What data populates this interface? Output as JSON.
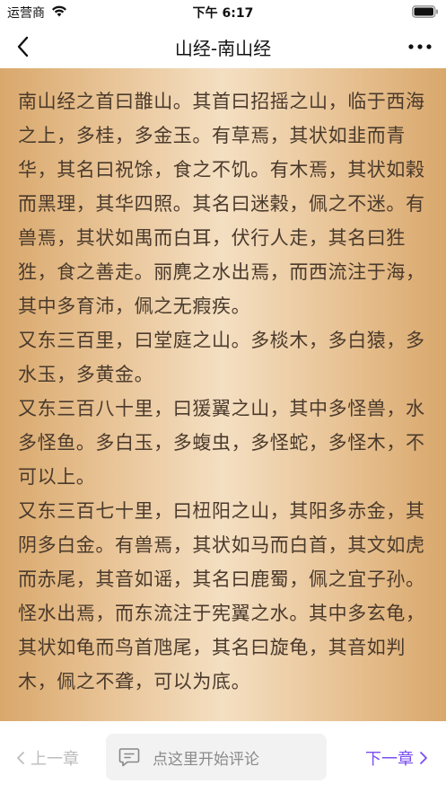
{
  "status": {
    "carrier": "运营商",
    "time": "下午 6:17"
  },
  "nav": {
    "title": "山经-南山经"
  },
  "content": {
    "paragraphs": [
      "南山经之首曰䧿山。其首曰招摇之山，临于西海之上，多桂，多金玉。有草焉，其状如韭而青华，其名曰祝馀，食之不饥。有木焉，其状如榖而黑理，其华四照。其名曰迷榖，佩之不迷。有兽焉，其状如禺而白耳，伏行人走，其名曰狌狌，食之善走。丽麂之水出焉，而西流注于海，其中多育沛，佩之无瘕疾。",
      "又东三百里，曰堂庭之山。多棪木，多白猿，多水玉，多黄金。",
      "又东三百八十里，曰猨翼之山，其中多怪兽，水多怪鱼。多白玉，多蝮虫，多怪蛇，多怪木，不可以上。",
      "又东三百七十里，曰杻阳之山，其阳多赤金，其阴多白金。有兽焉，其状如马而白首，其文如虎而赤尾，其音如谣，其名曰鹿蜀，佩之宜子孙。怪水出焉，而东流注于宪翼之水。其中多玄龟，其状如龟而鸟首虺尾，其名曰旋龟，其音如判木，佩之不聋，可以为底。"
    ]
  },
  "footer": {
    "prev_label": "上一章",
    "comment_placeholder": "点这里开始评论",
    "next_label": "下一章"
  },
  "colors": {
    "accent": "#7a4ef0",
    "paper_edge": "#d9a86c",
    "paper_center": "#f4dfc2",
    "text": "#4a3a2c"
  },
  "icons": [
    "wifi-icon",
    "battery-icon",
    "back-icon",
    "more-icon",
    "chevron-left-icon",
    "comment-icon",
    "chevron-right-icon"
  ]
}
